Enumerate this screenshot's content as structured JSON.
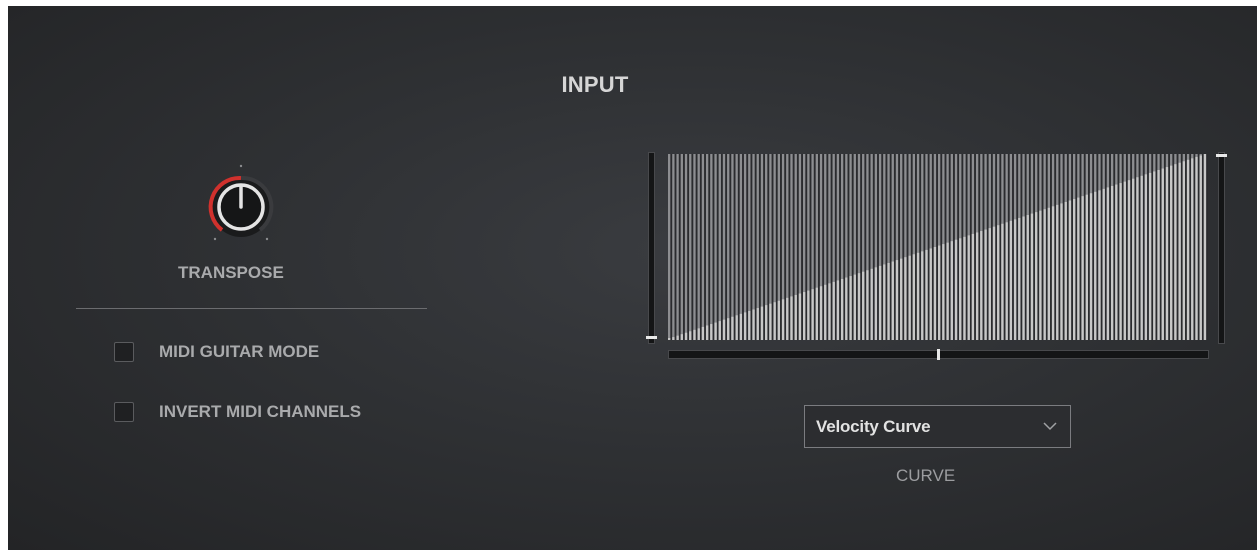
{
  "section": {
    "title": "INPUT"
  },
  "transpose": {
    "label": "TRANSPOSE"
  },
  "options": {
    "midi_guitar_mode": {
      "label": "MIDI GUITAR MODE",
      "checked": false
    },
    "invert_midi_channels": {
      "label": "INVERT MIDI CHANNELS",
      "checked": false
    }
  },
  "curve": {
    "dropdown_value": "Velocity Curve",
    "label": "CURVE",
    "bars": 128,
    "shape": "linear",
    "low_level": 0.0,
    "high_level": 1.0,
    "bend": 0.5
  },
  "colors": {
    "knob_accent": "#d0312d",
    "bar_fill": "#c8c8c8",
    "text": "#a9aaac"
  },
  "icons": {
    "dropdown": "chevron-down-icon"
  }
}
